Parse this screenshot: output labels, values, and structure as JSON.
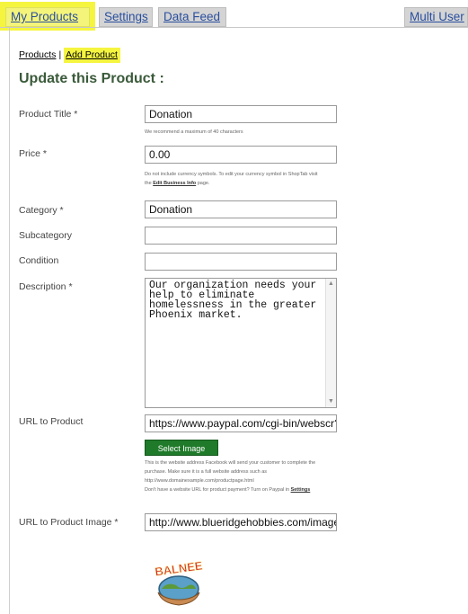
{
  "tabs": [
    {
      "label": "My Products",
      "active": true
    },
    {
      "label": "Settings",
      "active": false
    },
    {
      "label": "Data Feed",
      "active": false
    },
    {
      "label": "Multi User",
      "active": false
    }
  ],
  "breadcrumb": {
    "products": "Products",
    "separator": "|",
    "add_product": "Add Product"
  },
  "page_title": "Update this Product :",
  "required_marker": "*",
  "fields": {
    "product_title": {
      "label": "Product Title",
      "value": "Donation",
      "help": "We recommend a maximum of 40 characters"
    },
    "price": {
      "label": "Price",
      "value": "0.00",
      "help_1": "Do not include currency symbols. To edit your currency symbol in ShopTab visit",
      "help_link": "Edit Business Info",
      "help_2": "page."
    },
    "category": {
      "label": "Category",
      "value": "Donation"
    },
    "subcategory": {
      "label": "Subcategory",
      "value": ""
    },
    "condition": {
      "label": "Condition",
      "value": ""
    },
    "description": {
      "label": "Description",
      "value": "Our organization needs your help to eliminate homelessness in the greater Phoenix market."
    },
    "url_to_product": {
      "label": "URL to Product",
      "value": "https://www.paypal.com/cgi-bin/webscr?c",
      "help_1": "This is the website address Facebook will send your customer to complete the",
      "help_2": "purchase. Make sure it is a full website address such as",
      "help_3": "http://www.domainexample.com/productpage.html",
      "help_4": "Don't have a website URL for product payment? Turn on Paypal in",
      "help_link": "Settings"
    },
    "url_to_product_image": {
      "label": "URL to Product Image",
      "value": "http://www.blueridgehobbies.com/images"
    }
  },
  "select_image_label": "Select Image",
  "logo_text": "BALNEE",
  "colors": {
    "highlight": "#f5f540",
    "tab_inactive": "#d4d4d4",
    "title_green": "#3a5a3a",
    "button_green": "#1f7a2a"
  }
}
